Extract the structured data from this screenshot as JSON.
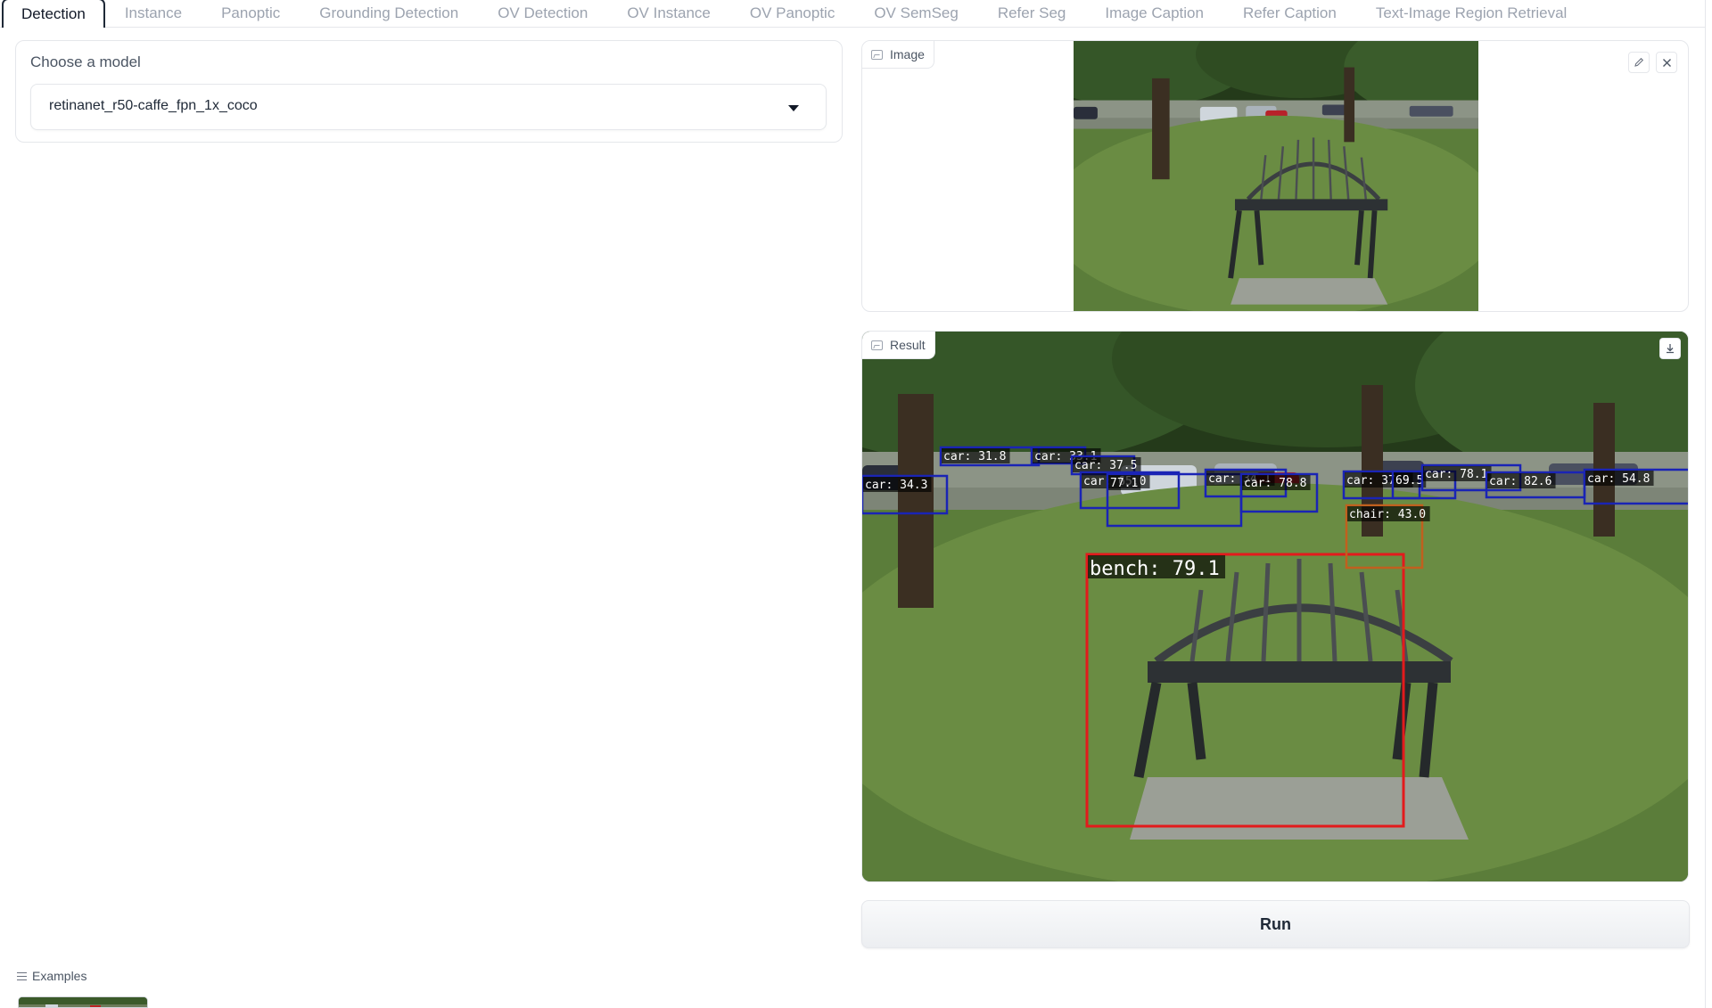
{
  "tabs": [
    {
      "label": "Detection",
      "active": true
    },
    {
      "label": "Instance"
    },
    {
      "label": "Panoptic"
    },
    {
      "label": "Grounding Detection"
    },
    {
      "label": "OV Detection"
    },
    {
      "label": "OV Instance"
    },
    {
      "label": "OV Panoptic"
    },
    {
      "label": "OV SemSeg"
    },
    {
      "label": "Refer Seg"
    },
    {
      "label": "Image Caption"
    },
    {
      "label": "Refer Caption"
    },
    {
      "label": "Text-Image Region Retrieval"
    }
  ],
  "model": {
    "label": "Choose a model",
    "selected": "retinanet_r50-caffe_fpn_1x_coco"
  },
  "image_panel": {
    "label": "Image",
    "edit_icon": "pencil-icon",
    "close_icon": "close-icon"
  },
  "result_panel": {
    "label": "Result",
    "download_icon": "download-icon"
  },
  "run_button": "Run",
  "examples": {
    "label": "Examples"
  },
  "detections": [
    {
      "label": "bench: 79.1",
      "color": "#e31a1c"
    },
    {
      "label": "chair: 43.0",
      "color": "#c0601e"
    },
    {
      "label": "car: 34.3",
      "color": "#1a24b5"
    },
    {
      "label": "car: 31.8",
      "color": "#1a24b5"
    },
    {
      "label": "car: 33.1",
      "color": "#1a24b5"
    },
    {
      "label": "car: 37.5",
      "color": "#1a24b5"
    },
    {
      "label": "car: 65.0",
      "color": "#1a24b5"
    },
    {
      "label": "77.1",
      "color": "#1a24b5"
    },
    {
      "label": "car: 34.1",
      "color": "#1a24b5"
    },
    {
      "label": "car: 78.8",
      "color": "#1a24b5"
    },
    {
      "label": "car: 37.5",
      "color": "#1a24b5"
    },
    {
      "label": "69.5",
      "color": "#1a24b5"
    },
    {
      "label": "car: 78.1",
      "color": "#1a24b5"
    },
    {
      "label": "car: 82.6",
      "color": "#1a24b5"
    },
    {
      "label": "car: 54.8",
      "color": "#1a24b5"
    }
  ]
}
